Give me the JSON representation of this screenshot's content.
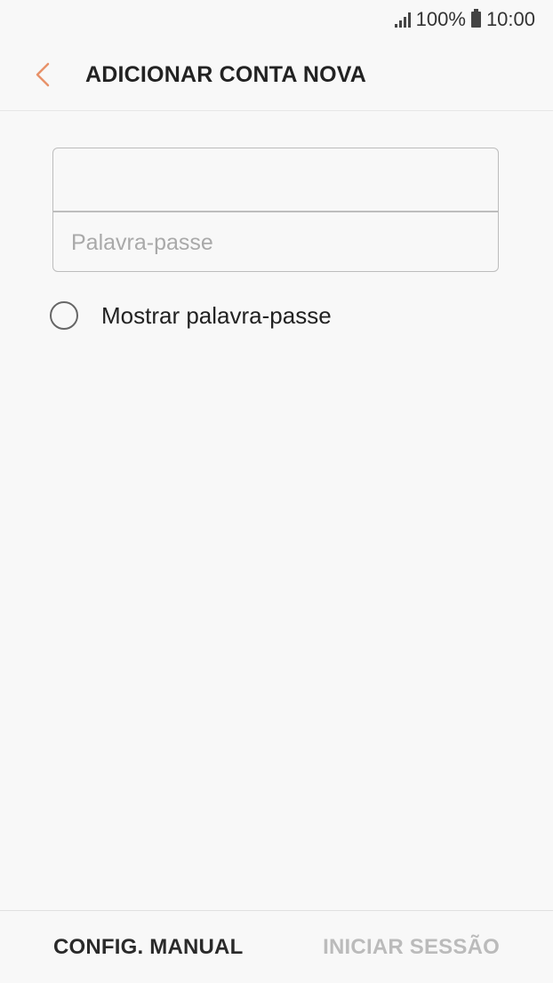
{
  "status_bar": {
    "battery_percent": "100%",
    "time": "10:00",
    "signal_icon": "signal-bars-icon",
    "battery_icon": "battery-icon"
  },
  "header": {
    "back_icon": "chevron-left-icon",
    "title": "ADICIONAR CONTA NOVA",
    "accent_color": "#e8926a"
  },
  "form": {
    "email_value": "",
    "email_placeholder": "",
    "password_value": "",
    "password_placeholder": "Palavra-passe"
  },
  "show_password": {
    "label": "Mostrar palavra-passe",
    "checked": false
  },
  "footer": {
    "manual_label": "CONFIG. MANUAL",
    "signin_label": "INICIAR SESSÃO",
    "signin_enabled": false
  }
}
